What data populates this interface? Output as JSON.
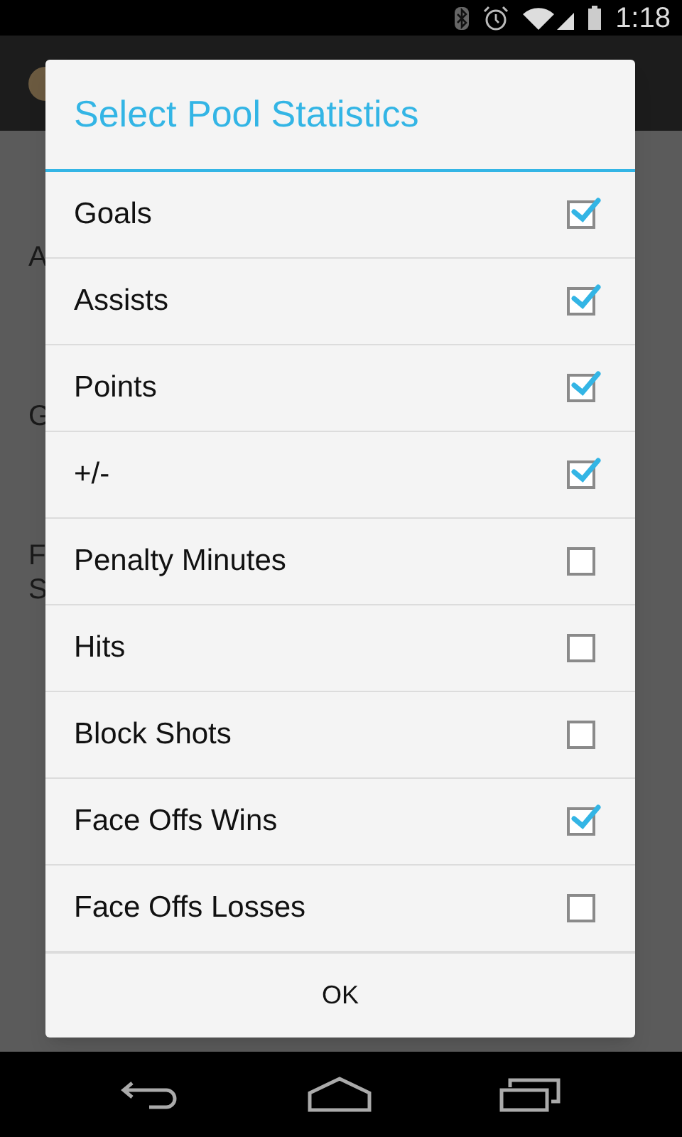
{
  "status_bar": {
    "time": "1:18"
  },
  "background": {
    "labels": [
      "A",
      "G",
      "F",
      "S"
    ]
  },
  "dialog": {
    "title": "Select Pool Statistics",
    "items": [
      {
        "label": "Goals",
        "checked": true
      },
      {
        "label": "Assists",
        "checked": true
      },
      {
        "label": "Points",
        "checked": true
      },
      {
        "label": "+/-",
        "checked": true
      },
      {
        "label": "Penalty Minutes",
        "checked": false
      },
      {
        "label": "Hits",
        "checked": false
      },
      {
        "label": "Block Shots",
        "checked": false
      },
      {
        "label": "Face Offs Wins",
        "checked": true
      },
      {
        "label": "Face Offs Losses",
        "checked": false
      }
    ],
    "button": "OK"
  }
}
